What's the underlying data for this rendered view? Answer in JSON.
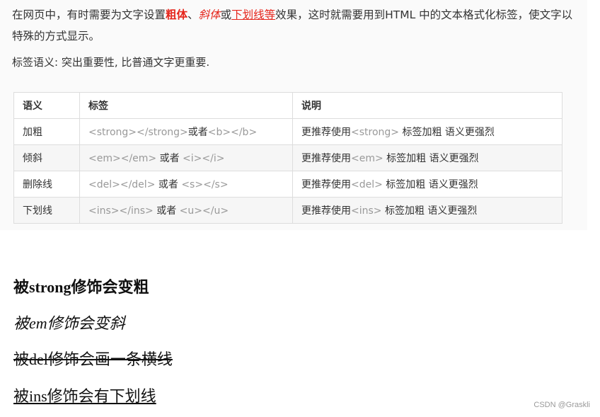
{
  "intro": {
    "p1": "在网页中，有时需要为文字设置",
    "bold": "粗体",
    "sep1": "、",
    "italic": "斜体",
    "p2": "或",
    "underline": "下划线等",
    "p3": "效果，这时就需要用到HTML 中的文本格式化标签，使文字以特殊的方式显示。"
  },
  "semantics": "标签语义: 突出重要性, 比普通文字更重要.",
  "table": {
    "headers": [
      "语义",
      "标签",
      "说明"
    ],
    "rows": [
      {
        "sem": "加粗",
        "tag_a": "<strong></strong>",
        "or": "或者",
        "tag_b": "<b></b>",
        "desc_pre": "更推荐使用",
        "desc_tag": "<strong>",
        "desc_post": " 标签加粗 语义更强烈"
      },
      {
        "sem": "倾斜",
        "tag_a": "<em></em>",
        "or": " 或者 ",
        "tag_b": "<i></i>",
        "desc_pre": "更推荐使用",
        "desc_tag": "<em>",
        "desc_post": " 标签加粗 语义更强烈"
      },
      {
        "sem": "删除线",
        "tag_a": "<del></del>",
        "or": " 或者 ",
        "tag_b": "<s></s>",
        "desc_pre": "更推荐使用",
        "desc_tag": "<del>",
        "desc_post": " 标签加粗 语义更强烈"
      },
      {
        "sem": "下划线",
        "tag_a": "<ins></ins>",
        "or": " 或者 ",
        "tag_b": "<u></u>",
        "desc_pre": "更推荐使用",
        "desc_tag": "<ins>",
        "desc_post": " 标签加粗 语义更强烈"
      }
    ]
  },
  "demos": {
    "strong": "被strong修饰会变粗",
    "em": "被em修饰会变斜",
    "del": "被del修饰会画一条横线",
    "ins": "被ins修饰会有下划线"
  },
  "watermark": "CSDN @Graskli"
}
